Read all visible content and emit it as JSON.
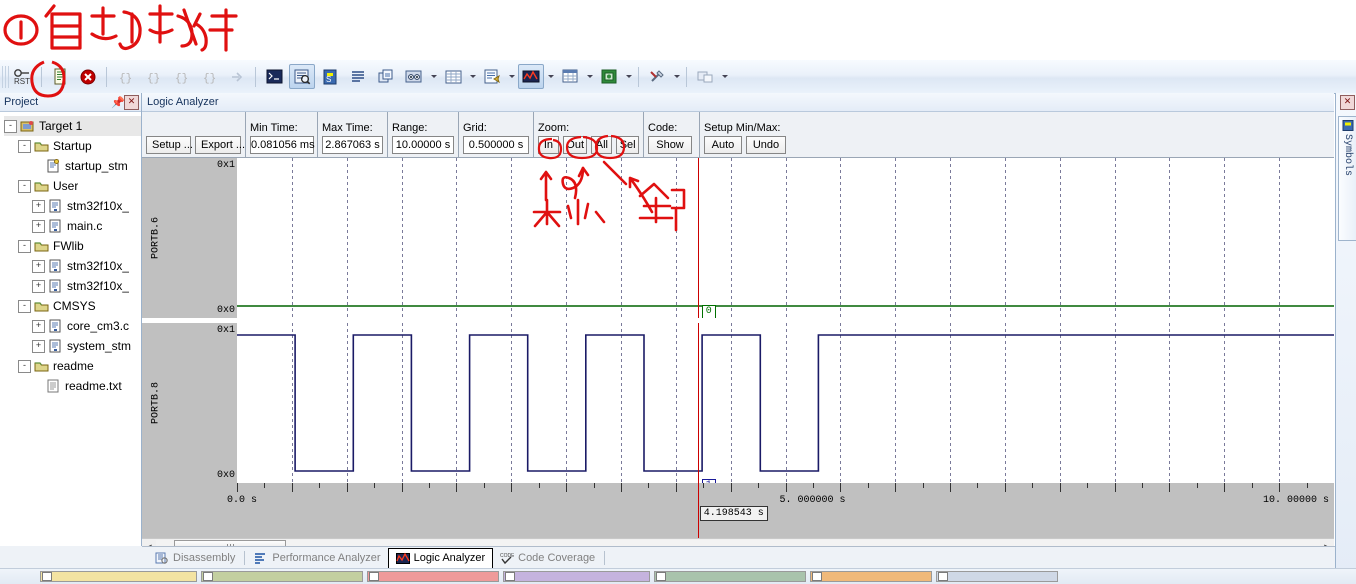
{
  "window": {
    "project_pane_title": "Project",
    "logic_analyzer_title": "Logic Analyzer",
    "symbols_pane_title": "Symbols"
  },
  "toolbar": {
    "items": [
      {
        "name": "reset-button",
        "label": "RST"
      },
      {
        "name": "run-to-main-button",
        "label": ""
      },
      {
        "name": "stop-debug-button",
        "label": ""
      },
      {
        "name": "step-into-button",
        "label": "{ }"
      },
      {
        "name": "step-over-button",
        "label": "{ }"
      },
      {
        "name": "step-out-button",
        "label": "{ }"
      },
      {
        "name": "run-to-cursor-button",
        "label": "{ }"
      },
      {
        "name": "show-next-statement-button",
        "label": ""
      },
      {
        "name": "command-window-button",
        "label": ""
      },
      {
        "name": "disassembly-window-button",
        "label": ""
      },
      {
        "name": "symbols-window-button",
        "label": ""
      },
      {
        "name": "registers-window-button",
        "label": ""
      },
      {
        "name": "call-stack-window-button",
        "label": ""
      },
      {
        "name": "watch-windows-button",
        "label": ""
      },
      {
        "name": "memory-windows-button",
        "label": ""
      },
      {
        "name": "serial-windows-button",
        "label": ""
      },
      {
        "name": "analysis-windows-button",
        "label": ""
      },
      {
        "name": "trace-windows-button",
        "label": ""
      },
      {
        "name": "system-viewer-button",
        "label": ""
      },
      {
        "name": "toolbox-button",
        "label": ""
      },
      {
        "name": "debug-restore-views-button",
        "label": ""
      }
    ]
  },
  "project_tree": [
    {
      "label": "Target 1",
      "indent": 0,
      "expander": "-",
      "icon": "target",
      "selected": true
    },
    {
      "label": "Startup",
      "indent": 1,
      "expander": "-",
      "icon": "folder",
      "selected": false
    },
    {
      "label": "startup_stm",
      "indent": 2,
      "expander": "",
      "icon": "asmfile",
      "selected": false
    },
    {
      "label": "User",
      "indent": 1,
      "expander": "-",
      "icon": "folder",
      "selected": false
    },
    {
      "label": "stm32f10x_",
      "indent": 2,
      "expander": "+",
      "icon": "cfile",
      "selected": false
    },
    {
      "label": "main.c",
      "indent": 2,
      "expander": "+",
      "icon": "cfile",
      "selected": false
    },
    {
      "label": "FWlib",
      "indent": 1,
      "expander": "-",
      "icon": "folder",
      "selected": false
    },
    {
      "label": "stm32f10x_",
      "indent": 2,
      "expander": "+",
      "icon": "cfile",
      "selected": false
    },
    {
      "label": "stm32f10x_",
      "indent": 2,
      "expander": "+",
      "icon": "cfile",
      "selected": false
    },
    {
      "label": "CMSYS",
      "indent": 1,
      "expander": "-",
      "icon": "folder",
      "selected": false
    },
    {
      "label": "core_cm3.c",
      "indent": 2,
      "expander": "+",
      "icon": "cfile",
      "selected": false
    },
    {
      "label": "system_stm",
      "indent": 2,
      "expander": "+",
      "icon": "cfile",
      "selected": false
    },
    {
      "label": "readme",
      "indent": 1,
      "expander": "-",
      "icon": "folder",
      "selected": false
    },
    {
      "label": "readme.txt",
      "indent": 2,
      "expander": "",
      "icon": "txtfile",
      "selected": false
    }
  ],
  "la_controls": {
    "setup_label": "Setup ...",
    "export_label": "Export ...",
    "min_time_caption": "Min Time:",
    "min_time_value": "0.081056 ms",
    "max_time_caption": "Max Time:",
    "max_time_value": "2.867063 s",
    "range_caption": "Range:",
    "range_value": "10.00000 s",
    "grid_caption": "Grid:",
    "grid_value": "0.500000 s",
    "zoom_caption": "Zoom:",
    "zoom_in_label": "In",
    "zoom_out_label": "Out",
    "zoom_all_label": "All",
    "zoom_sel_label": "Sel",
    "code_caption": "Code:",
    "code_show_label": "Show",
    "setup_minmax_caption": "Setup Min/Max:",
    "auto_label": "Auto",
    "undo_label": "Undo"
  },
  "signals": [
    {
      "name": "PORTB.6",
      "high_label": "0x1",
      "low_label": "0x0",
      "color": "#006400",
      "cursor_value": "0",
      "cursor_value_color": "#007000",
      "transitions_pct": []
    },
    {
      "name": "PORTB.8",
      "high_label": "0x1",
      "low_label": "0x0",
      "color": "#1a1a66",
      "cursor_value": "1",
      "cursor_value_color": "#1a1a99",
      "transitions_pct": [
        0,
        5.3,
        10.6,
        15.9,
        21.2,
        26.5,
        31.8,
        37.1,
        42.4,
        47.7,
        53.0
      ]
    }
  ],
  "time_axis": {
    "start_label": "0.0  s",
    "mid_label": "5. 000000  s",
    "end_label": "10. 00000  s",
    "cursor_label": "4.198543  s",
    "cursor_pct": 42.0,
    "grid_count": 20
  },
  "bottom_tabs": [
    {
      "label": "Disassembly",
      "icon": "disassembly-icon",
      "active": false
    },
    {
      "label": "Performance Analyzer",
      "icon": "performance-icon",
      "active": false
    },
    {
      "label": "Logic Analyzer",
      "icon": "logic-icon",
      "active": true
    },
    {
      "label": "Code Coverage",
      "icon": "coverage-icon",
      "active": false
    }
  ],
  "annotations": {
    "top_note": "①自动执行",
    "zoom_notes": [
      "大",
      "小、",
      "全部"
    ]
  },
  "colors": {
    "accent_red": "#e01010",
    "signal_green": "#006400",
    "signal_blue": "#1a1a66",
    "cursor_red": "#cc0000",
    "panel_grey": "#c0c0c0"
  }
}
